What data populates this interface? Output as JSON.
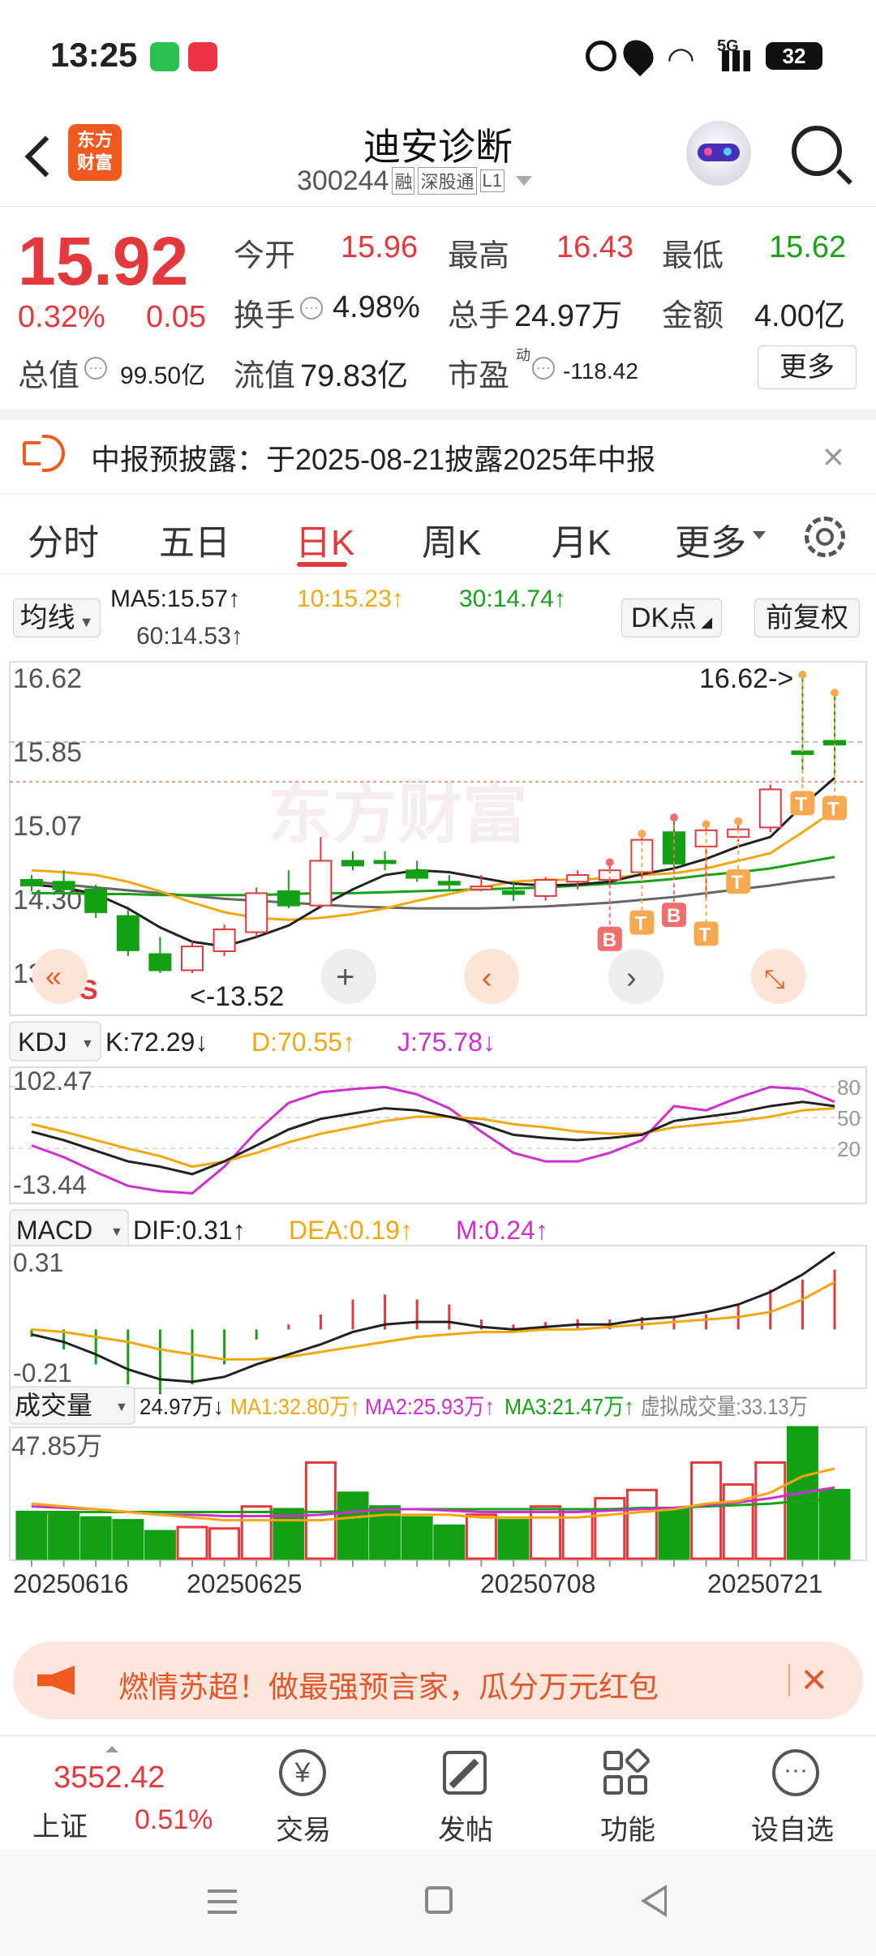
{
  "status_bar": {
    "time": "13:25",
    "battery": "32",
    "network": "5G"
  },
  "header": {
    "app_logo": "东方\n财富",
    "stock_name": "迪安诊断",
    "stock_code": "300244",
    "badges": [
      "融",
      "深股通",
      "L1"
    ]
  },
  "quote": {
    "price": "15.92",
    "change_pct": "0.32%",
    "change": "0.05",
    "open_label": "今开",
    "open": "15.96",
    "high_label": "最高",
    "high": "16.43",
    "low_label": "最低",
    "low": "15.62",
    "turnover_label": "换手",
    "turnover": "4.98%",
    "volume_label": "总手",
    "volume": "24.97万",
    "amount_label": "金额",
    "amount": "4.00亿",
    "mcap_label": "总值",
    "mcap": "99.50亿",
    "float_label": "流值",
    "float": "79.83亿",
    "pe_label": "市盈",
    "pe_sup": "动",
    "pe": "-118.42",
    "more_button": "更多"
  },
  "notice": {
    "text": "中报预披露：于2025-08-21披露2025年中报"
  },
  "tabs": {
    "items": [
      "分时",
      "五日",
      "日K",
      "周K",
      "月K",
      "更多"
    ],
    "active": "日K"
  },
  "ma_bar": {
    "selector": "均线",
    "ma5": "MA5:15.57↑",
    "ma10": "10:15.23↑",
    "ma30": "30:14.74↑",
    "ma60": "60:14.53↑",
    "dk_button": "DK点",
    "adjust_button": "前复权"
  },
  "kline": {
    "y_labels": [
      "16.62",
      "15.85",
      "15.07",
      "14.30",
      "13.52"
    ],
    "max_marker": "16.62->",
    "min_marker": "<-13.52",
    "signal_b": "B",
    "signal_t": "T",
    "signal_s": "S",
    "watermark": "东方财富"
  },
  "kdj": {
    "selector": "KDJ",
    "k": "K:72.29↓",
    "d": "D:70.55↑",
    "j": "J:75.78↓",
    "y_top": "102.47",
    "y_bottom": "-13.44",
    "ref_levels": [
      "80",
      "50",
      "20"
    ]
  },
  "macd": {
    "selector": "MACD",
    "dif": "DIF:0.31↑",
    "dea": "DEA:0.19↑",
    "m": "M:0.24↑",
    "y_top": "0.31",
    "y_bottom": "-0.21"
  },
  "volume": {
    "selector": "成交量",
    "vol": "24.97万↓",
    "ma1": "MA1:32.80万↑",
    "ma2": "MA2:25.93万↑",
    "ma3": "MA3:21.47万↑",
    "virtual": "虚拟成交量:33.13万",
    "y_top": "47.85万"
  },
  "dates": [
    "20250616",
    "20250625",
    "20250708",
    "20250721"
  ],
  "promo": {
    "text": "燃情苏超！做最强预言家，瓜分万元红包"
  },
  "bottom_nav": {
    "index_value": "3552.42",
    "index_name": "上证",
    "index_change": "0.51%",
    "items": [
      "交易",
      "发帖",
      "功能",
      "设自选"
    ]
  },
  "colors": {
    "up": "#e4393c",
    "down": "#14a014",
    "ma5": "#222222",
    "ma10": "#f2a70f",
    "ma30": "#16a316",
    "ma60": "#666666"
  },
  "chart_data": {
    "type": "candlestick",
    "candles": [
      {
        "o": 14.5,
        "h": 14.55,
        "l": 14.38,
        "c": 14.44
      },
      {
        "o": 14.48,
        "h": 14.6,
        "l": 14.35,
        "c": 14.4
      },
      {
        "o": 14.4,
        "h": 14.45,
        "l": 14.1,
        "c": 14.16
      },
      {
        "o": 14.12,
        "h": 14.18,
        "l": 13.7,
        "c": 13.76
      },
      {
        "o": 13.72,
        "h": 13.9,
        "l": 13.52,
        "c": 13.55
      },
      {
        "o": 13.55,
        "h": 13.85,
        "l": 13.52,
        "c": 13.8
      },
      {
        "o": 13.75,
        "h": 14.03,
        "l": 13.7,
        "c": 13.98
      },
      {
        "o": 13.95,
        "h": 14.42,
        "l": 13.9,
        "c": 14.36
      },
      {
        "o": 14.38,
        "h": 14.6,
        "l": 14.2,
        "c": 14.23
      },
      {
        "o": 14.23,
        "h": 14.95,
        "l": 14.2,
        "c": 14.7
      },
      {
        "o": 14.7,
        "h": 14.8,
        "l": 14.6,
        "c": 14.65
      },
      {
        "o": 14.7,
        "h": 14.8,
        "l": 14.6,
        "c": 14.68
      },
      {
        "o": 14.6,
        "h": 14.7,
        "l": 14.48,
        "c": 14.52
      },
      {
        "o": 14.48,
        "h": 14.55,
        "l": 14.4,
        "c": 14.45
      },
      {
        "o": 14.4,
        "h": 14.55,
        "l": 14.38,
        "c": 14.43
      },
      {
        "o": 14.38,
        "h": 14.48,
        "l": 14.28,
        "c": 14.35
      },
      {
        "o": 14.33,
        "h": 14.53,
        "l": 14.28,
        "c": 14.5
      },
      {
        "o": 14.48,
        "h": 14.6,
        "l": 14.4,
        "c": 14.55
      },
      {
        "o": 14.5,
        "h": 14.65,
        "l": 14.45,
        "c": 14.6
      },
      {
        "o": 14.58,
        "h": 14.95,
        "l": 14.52,
        "c": 14.92
      },
      {
        "o": 15.0,
        "h": 15.12,
        "l": 14.6,
        "c": 14.67
      },
      {
        "o": 14.85,
        "h": 15.05,
        "l": 14.3,
        "c": 15.02
      },
      {
        "o": 14.95,
        "h": 15.08,
        "l": 14.9,
        "c": 15.03
      },
      {
        "o": 15.05,
        "h": 15.5,
        "l": 15.0,
        "c": 15.45
      },
      {
        "o": 15.85,
        "h": 16.62,
        "l": 15.62,
        "c": 15.82
      },
      {
        "o": 15.96,
        "h": 16.43,
        "l": 15.62,
        "c": 15.92
      }
    ],
    "ma5": [
      14.45,
      14.42,
      14.35,
      14.2,
      14.0,
      13.85,
      13.8,
      13.9,
      14.02,
      14.22,
      14.4,
      14.55,
      14.6,
      14.58,
      14.52,
      14.46,
      14.44,
      14.45,
      14.48,
      14.56,
      14.62,
      14.72,
      14.85,
      14.95,
      15.28,
      15.57
    ],
    "ma10": [
      14.6,
      14.58,
      14.55,
      14.48,
      14.38,
      14.26,
      14.16,
      14.1,
      14.08,
      14.1,
      14.14,
      14.2,
      14.28,
      14.35,
      14.42,
      14.48,
      14.5,
      14.5,
      14.52,
      14.55,
      14.57,
      14.62,
      14.7,
      14.78,
      15.0,
      15.23
    ],
    "ma30": [
      14.36,
      14.36,
      14.35,
      14.35,
      14.34,
      14.34,
      14.34,
      14.34,
      14.35,
      14.36,
      14.36,
      14.37,
      14.38,
      14.39,
      14.4,
      14.41,
      14.42,
      14.44,
      14.46,
      14.48,
      14.51,
      14.55,
      14.58,
      14.62,
      14.68,
      14.74
    ],
    "ma60": [
      14.48,
      14.45,
      14.42,
      14.39,
      14.36,
      14.33,
      14.3,
      14.28,
      14.26,
      14.24,
      14.22,
      14.21,
      14.2,
      14.2,
      14.2,
      14.21,
      14.22,
      14.24,
      14.26,
      14.29,
      14.32,
      14.36,
      14.4,
      14.44,
      14.49,
      14.53
    ],
    "kdj_k": [
      48,
      40,
      30,
      20,
      15,
      8,
      20,
      35,
      50,
      60,
      65,
      70,
      68,
      62,
      55,
      45,
      42,
      40,
      42,
      45,
      58,
      62,
      66,
      72,
      76,
      72
    ],
    "kdj_d": [
      55,
      48,
      40,
      32,
      25,
      15,
      20,
      28,
      38,
      46,
      52,
      58,
      62,
      62,
      60,
      55,
      52,
      48,
      46,
      46,
      52,
      55,
      58,
      62,
      68,
      70
    ],
    "kdj_j": [
      35,
      24,
      10,
      -3,
      -8,
      -10,
      15,
      48,
      75,
      85,
      88,
      90,
      83,
      70,
      48,
      28,
      20,
      20,
      28,
      40,
      72,
      68,
      80,
      90,
      88,
      76
    ],
    "dif": [
      -0.02,
      -0.05,
      -0.1,
      -0.16,
      -0.2,
      -0.21,
      -0.19,
      -0.14,
      -0.1,
      -0.06,
      -0.01,
      0.02,
      0.03,
      0.03,
      0.01,
      0.0,
      0.01,
      0.02,
      0.02,
      0.04,
      0.05,
      0.07,
      0.1,
      0.15,
      0.22,
      0.31
    ],
    "dea": [
      0.0,
      -0.01,
      -0.03,
      -0.05,
      -0.08,
      -0.1,
      -0.12,
      -0.12,
      -0.11,
      -0.09,
      -0.07,
      -0.05,
      -0.03,
      -0.02,
      -0.01,
      -0.01,
      0.0,
      0.0,
      0.01,
      0.02,
      0.03,
      0.04,
      0.05,
      0.07,
      0.12,
      0.19
    ],
    "macd_m": [
      -0.03,
      -0.08,
      -0.14,
      -0.22,
      -0.26,
      -0.22,
      -0.14,
      -0.04,
      0.02,
      0.06,
      0.12,
      0.14,
      0.12,
      0.1,
      0.04,
      0.02,
      0.03,
      0.04,
      0.04,
      0.05,
      0.05,
      0.06,
      0.1,
      0.16,
      0.2,
      0.24
    ],
    "volume": [
      17.0,
      16.5,
      15.0,
      14.0,
      10.0,
      11.5,
      11.0,
      19.0,
      18.0,
      35.0,
      24.0,
      19.0,
      15.0,
      12.0,
      16.0,
      14.0,
      19.0,
      18.0,
      22.0,
      25.0,
      18.0,
      35.0,
      27.0,
      35.0,
      47.85,
      24.97
    ],
    "vol_ma1": [
      20,
      19,
      18,
      17,
      16,
      15,
      14,
      14,
      14,
      14,
      15,
      16,
      16,
      16,
      15,
      15,
      15,
      15,
      16,
      17,
      18,
      20,
      21,
      24,
      30,
      32.8
    ],
    "vol_ma2": [
      19,
      18.5,
      18,
      17,
      16,
      16,
      15.5,
      15.5,
      15.5,
      16,
      17,
      18,
      18,
      17.5,
      17,
      17,
      17,
      17,
      17.5,
      18,
      18.5,
      19.5,
      20.5,
      22,
      24,
      25.93
    ],
    "vol_ma3": [
      17,
      17,
      17,
      17,
      17,
      17,
      17,
      17,
      17,
      17,
      17.5,
      18,
      18,
      18,
      18,
      18,
      18,
      18,
      18,
      18.5,
      18.5,
      19,
      19.5,
      20,
      21,
      21.47
    ],
    "y_range": [
      13.52,
      16.62
    ]
  }
}
